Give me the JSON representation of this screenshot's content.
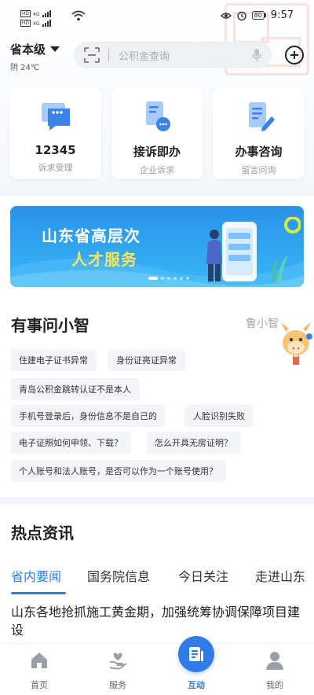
{
  "status_bar": {
    "time": "9:57",
    "battery": "80",
    "sim1": {
      "hd": "HD",
      "network": "4G"
    },
    "sim2": {
      "hd": "HD",
      "network": "4G"
    }
  },
  "header": {
    "location": "省本级",
    "weather": "阴 24℃",
    "search_placeholder": "公积金查询"
  },
  "service_cards": [
    {
      "title": "12345",
      "subtitle": "诉求受理",
      "icon": "chat-bubble-icon"
    },
    {
      "title": "接诉即办",
      "subtitle": "企业诉求",
      "icon": "document-chat-icon"
    },
    {
      "title": "办事咨询",
      "subtitle": "留言问询",
      "icon": "document-edit-icon"
    }
  ],
  "banner": {
    "line1": "山东省高层次",
    "line2": "人才服务"
  },
  "ask_section": {
    "title": "有事问小智",
    "assistant_name": "鲁小智",
    "chips": [
      "住建电子证书异常",
      "身份证亮证异常",
      "青岛公积金跳转认证不是本人",
      "手机号登录后，身份信息不是自己的",
      "人脸识别失败",
      "电子证照如何申领、下载？",
      "怎么开具无房证明？",
      "个人账号和法人账号，是否可以作为一个账号使用？"
    ]
  },
  "news": {
    "title": "热点资讯",
    "tabs": [
      "省内要闻",
      "国务院信息",
      "今日关注",
      "走进山东"
    ],
    "active_tab": 0,
    "headline": "山东各地抢抓施工黄金期，加强统筹协调保障项目建设"
  },
  "bottom_nav": {
    "items": [
      {
        "label": "首页",
        "icon": "home-icon"
      },
      {
        "label": "服务",
        "icon": "heart-hand-icon"
      },
      {
        "label": "互动",
        "icon": "interaction-icon"
      },
      {
        "label": "我的",
        "icon": "user-icon"
      }
    ],
    "active": 2
  },
  "colors": {
    "accent": "#2f7bea",
    "banner": "#2a93e8",
    "highlight": "#ffe45a"
  }
}
